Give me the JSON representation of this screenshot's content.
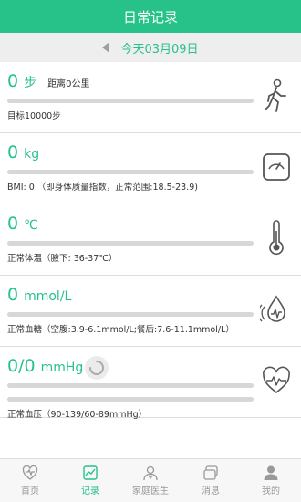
{
  "header": {
    "title": "日常记录"
  },
  "date_bar": {
    "date_label": "今天03月09日"
  },
  "metrics": {
    "steps": {
      "value": "0",
      "unit": "步",
      "sub": "距离0公里",
      "note": "目标10000步",
      "progress": 0
    },
    "weight": {
      "value": "0",
      "unit": "kg",
      "note": "BMI: 0 （即身体质量指数，正常范围:18.5-23.9)",
      "progress": 0
    },
    "temperature": {
      "value": "0",
      "unit": "℃",
      "note": "正常体温（腋下: 36-37℃）",
      "progress": 0
    },
    "glucose": {
      "value": "0",
      "unit": "mmol/L",
      "note": "正常血糖（空腹:3.9-6.1mmol/L;餐后:7.6-11.1mmol/L）",
      "progress": 0
    },
    "blood_pressure": {
      "value": "0/0",
      "unit": "mmHg",
      "note": "正常血压（90-139/60-89mmHg）",
      "progress": 0
    }
  },
  "tabs": [
    {
      "label": "首页",
      "icon": "heart-icon",
      "active": false
    },
    {
      "label": "记录",
      "icon": "chart-icon",
      "active": true
    },
    {
      "label": "家庭医生",
      "icon": "doctor-icon",
      "active": false
    },
    {
      "label": "消息",
      "icon": "message-icon",
      "active": false
    },
    {
      "label": "我的",
      "icon": "user-icon",
      "active": false
    }
  ],
  "colors": {
    "accent": "#27c28a",
    "bar_track": "#d7d7d7",
    "header_bg": "#27c28a"
  }
}
